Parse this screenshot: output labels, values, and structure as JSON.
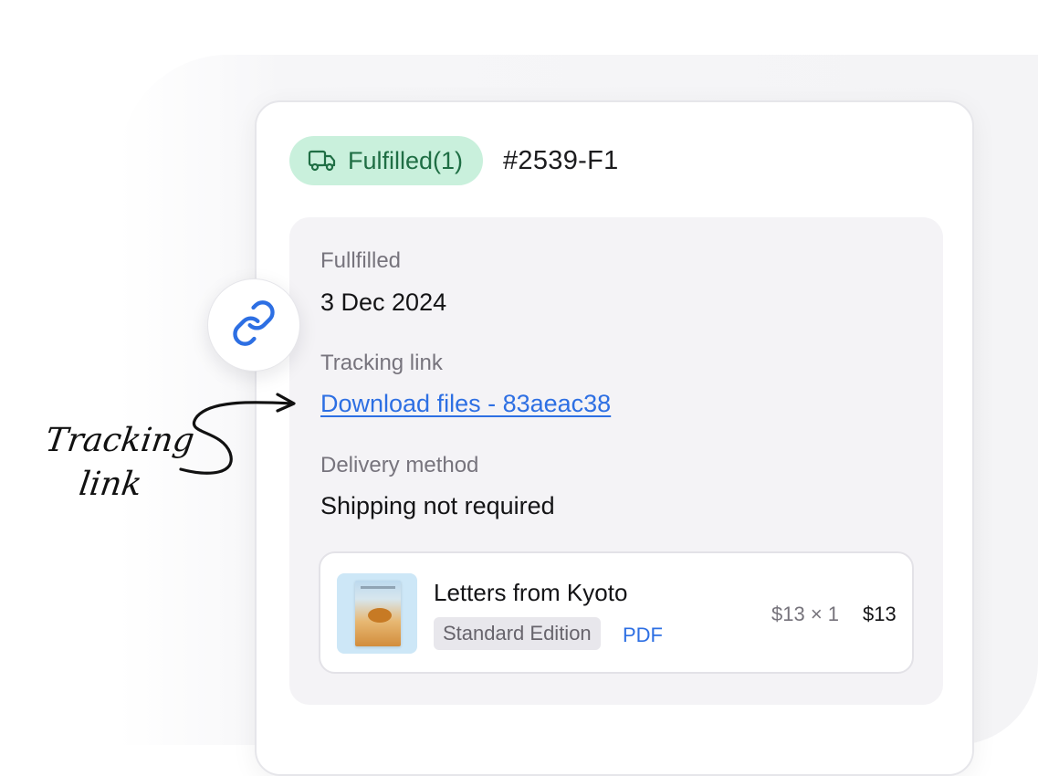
{
  "fulfillment": {
    "badge_label": "Fulfilled(1)",
    "order_id": "#2539-F1",
    "status_color": "#1f6e44"
  },
  "details": {
    "fulfilled_label": "Fullfilled",
    "fulfilled_date": "3 Dec 2024",
    "tracking_label": "Tracking link",
    "tracking_link_text": "Download files - 83aeac38",
    "delivery_label": "Delivery method",
    "delivery_value": "Shipping not required"
  },
  "product": {
    "title": "Letters from Kyoto",
    "edition": "Standard Edition",
    "format": "PDF",
    "unit_price_qty": "$13 × 1",
    "total": "$13"
  },
  "annotation": {
    "line1": "Tracking",
    "line2": "link"
  },
  "icons": {
    "badge_icon": "truck-icon",
    "floating_icon": "link-icon"
  },
  "colors": {
    "accent_link": "#2d6fe3",
    "badge_bg": "#c9f0dc"
  }
}
